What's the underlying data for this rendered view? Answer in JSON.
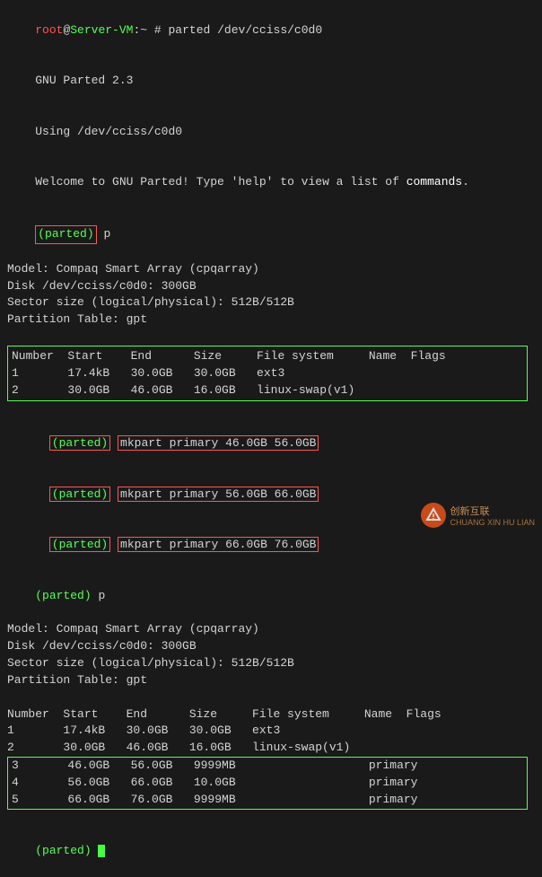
{
  "terminal": {
    "title": "Terminal",
    "lines": {
      "line1_prompt": "root@Server-VM",
      "line1_sep": ":",
      "line1_cmd": " # parted /dev/cciss/c0d0",
      "line2": "GNU Parted 2.3",
      "line3": "Using /dev/cciss/c0d0",
      "line4_pre": "Welcome to GNU Parted! Type 'help' to view a list of ",
      "line4_cmd": "commands",
      "line4_post": ".",
      "parted_p1_prompt": "(parted) ",
      "parted_p1_cmd": "p",
      "model": "Model: Compaq Smart Array (cpqarray)",
      "disk": "Disk /dev/cciss/c0d0: 300GB",
      "sector": "Sector size (logical/physical): 512B/512B",
      "partition_table": "Partition Table: gpt",
      "blank": "",
      "table_header": "Number  Start    End      Size     File system     Name  Flags",
      "row1": "1       17.4kB   30.0GB   30.0GB   ext3",
      "row2": "2       30.0GB   46.0GB   16.0GB   linux-swap(v1)",
      "blank2": "",
      "mkpart1_prompt": "(parted) ",
      "mkpart1_cmd": "mkpart primary 46.0GB 56.0GB",
      "mkpart2_prompt": "(parted) ",
      "mkpart2_cmd": "mkpart primary 56.0GB 66.0GB",
      "mkpart3_prompt": "(parted) ",
      "mkpart3_cmd": "mkpart primary 66.0GB 76.0GB",
      "parted_p2_prompt": "(parted) ",
      "parted_p2_cmd": "p",
      "model2": "Model: Compaq Smart Array (cpqarray)",
      "disk2": "Disk /dev/cciss/c0d0: 300GB",
      "sector2": "Sector size (logical/physical): 512B/512B",
      "partition_table2": "Partition Table: gpt",
      "blank3": "",
      "table_header2": "Number  Start    End      Size     File system     Name  Flags",
      "row1b": "1       17.4kB   30.0GB   30.0GB   ext3",
      "row2b": "2       30.0GB   46.0GB   16.0GB   linux-swap(v1)",
      "row3": "3       46.0GB   56.0GB   9999MB                   primary",
      "row4": "4       56.0GB   66.0GB   10.0GB                   primary",
      "row5": "5       66.0GB   76.0GB   9999MB                   primary",
      "blank4": "",
      "parted_final_prompt": "(parted) ",
      "cursor": ""
    }
  }
}
